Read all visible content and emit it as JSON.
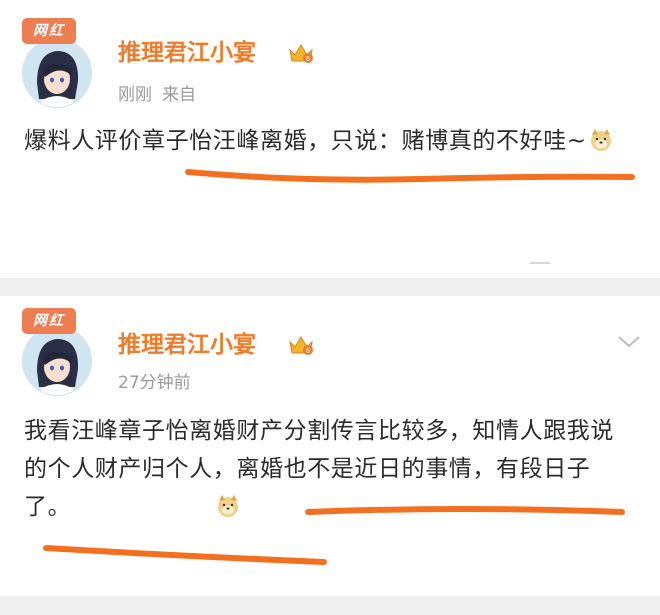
{
  "posts": [
    {
      "badge": "网红",
      "username": "推理君江小宴",
      "time": "刚刚",
      "source": "来自",
      "text": "爆料人评价章子怡汪峰离婚，只说：赌博真的不好哇~"
    },
    {
      "badge": "网红",
      "username": "推理君江小宴",
      "time": "27分钟前",
      "source": "",
      "text": "我看汪峰章子怡离婚财产分割传言比较多，知情人跟我说的个人财产归个人，离婚也不是近日的事情，有段日子了。"
    }
  ],
  "icons": {
    "crown": "crown-vip-icon",
    "emoji": "doge-emoji-icon",
    "expand": "chevron-down-icon"
  },
  "colors": {
    "username": "#f07b28",
    "badge": "#ec7e52",
    "highlight": "#f2701f",
    "meta": "#9a9a9a"
  }
}
